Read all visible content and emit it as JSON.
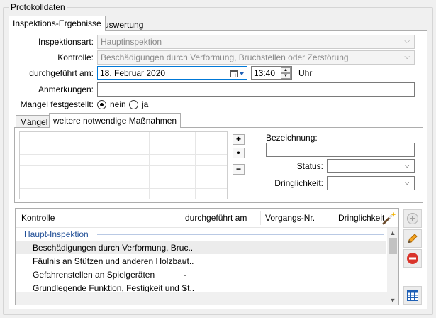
{
  "group_title": "Protokolldaten",
  "tabs": {
    "inspection": "Inspektions-Ergebnisse",
    "evaluation": "Auswertung"
  },
  "form": {
    "inspection_type_label": "Inspektionsart:",
    "inspection_type_value": "Hauptinspektion",
    "control_label": "Kontrolle:",
    "control_value": "Beschädigungen durch Verformung, Bruchstellen oder Zerstörung",
    "performed_label": "durchgeführt am:",
    "date_value": "18.  Februar   2020",
    "time_value": "13:40",
    "time_unit": "Uhr",
    "notes_label": "Anmerkungen:",
    "notes_value": "",
    "defect_label": "Mangel festgestellt:",
    "defect_no": "nein",
    "defect_yes": "ja",
    "defect_selected": "nein"
  },
  "inner_tabs": {
    "defects": "Mängel",
    "measures": "weitere notwendige Maßnahmen"
  },
  "measures": {
    "add_symbol": "+",
    "dot_symbol": "•",
    "remove_symbol": "−",
    "designation_label": "Bezeichnung:",
    "designation_value": "",
    "status_label": "Status:",
    "urgency_label": "Dringlichkeit:"
  },
  "table": {
    "columns": [
      "Kontrolle",
      "durchgeführt am",
      "Vorgangs-Nr.",
      "Dringlichkeit"
    ],
    "group_label": "Haupt-Inspektion",
    "rows": [
      {
        "control": "Beschädigungen durch Verformung, Bruc...",
        "date": "-",
        "selected": true
      },
      {
        "control": "Fäulnis an Stützen und anderen Holzbaut...",
        "date": "-",
        "selected": false
      },
      {
        "control": "Gefahrenstellen an Spielgeräten",
        "date": "-",
        "selected": false
      },
      {
        "control": "Grundlegende Funktion, Festigkeit und St...",
        "date": "-",
        "selected": false
      }
    ]
  },
  "icons": {
    "wand": "magic-wand-icon",
    "add": "add-circle-icon",
    "edit": "pencil-icon",
    "delete": "remove-circle-icon",
    "calendar": "calendar-icon",
    "scroll_up": "▲",
    "scroll_down": "▼",
    "chevron": "⌵"
  },
  "colors": {
    "group_header": "#1f4e96",
    "selected_row": "#ececec",
    "delete_red": "#d9342b"
  }
}
